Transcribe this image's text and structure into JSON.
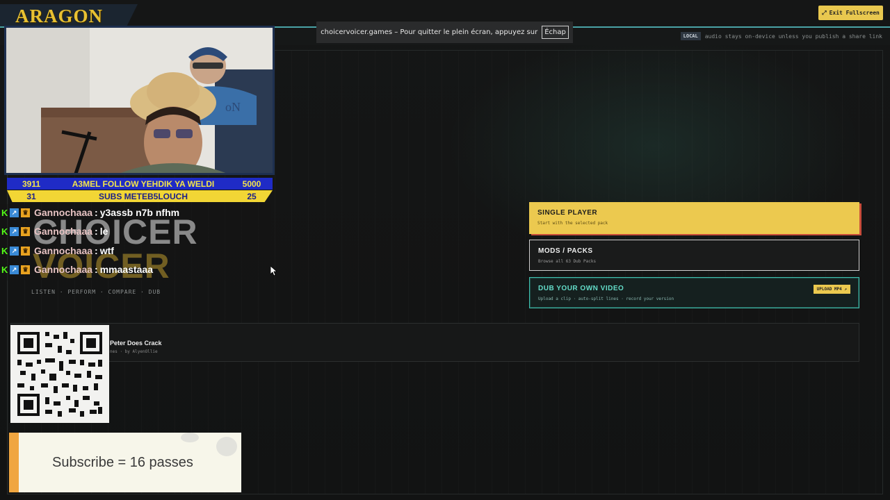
{
  "app": {
    "exit_fullscreen_label": "Exit Fullscreen",
    "local_badge": "LOCAL",
    "local_note": "audio stays on-device unless you publish a share link",
    "fullscreen_toast": "choicervoicer.games – Pour quitter le plein écran, appuyez sur",
    "esc_key": "Échap",
    "logo_line1": "CHOICER",
    "logo_line2": "VOICER",
    "nav": "LISTEN · PERFORM · COMPARE · DUB",
    "menu": {
      "single_title": "SINGLE PLAYER",
      "single_sub": "Start with the selected pack",
      "mods_title": "MODS / PACKS",
      "mods_sub": "Browse all 63 Dub Packs",
      "dub_title": "DUB YOUR OWN VIDEO",
      "dub_sub": "Upload a clip · auto-split lines · record your version",
      "upload_label": "UPLOAD MP4 ↗"
    },
    "pack": {
      "title": "Peter Does Crack",
      "subtitle": "nes · by AlyenOllie"
    }
  },
  "overlay": {
    "channel_logo": "ARAGON",
    "banner_top": {
      "left": "3911",
      "text": "A3MEL FOLLOW YEHDIK YA WELDI",
      "right": "5000"
    },
    "banner_bottom": {
      "left": "31",
      "text": "SUBS METEB5LOUCH",
      "right": "25"
    },
    "chat": [
      {
        "user": "Gannochaaa",
        "message": "y3assb n7b nfhm"
      },
      {
        "user": "Gannochaaa",
        "message": "le"
      },
      {
        "user": "Gannochaaa",
        "message": "wtf"
      },
      {
        "user": "Gannochaaa",
        "message": "mmaastaaa"
      }
    ],
    "subscribe_text": "Subscribe = 16 passes"
  },
  "colors": {
    "accent_yellow": "#ecc94f",
    "accent_teal": "#3fbfae",
    "banner_blue": "#1f2bc6",
    "kick_green": "#53fc18"
  }
}
